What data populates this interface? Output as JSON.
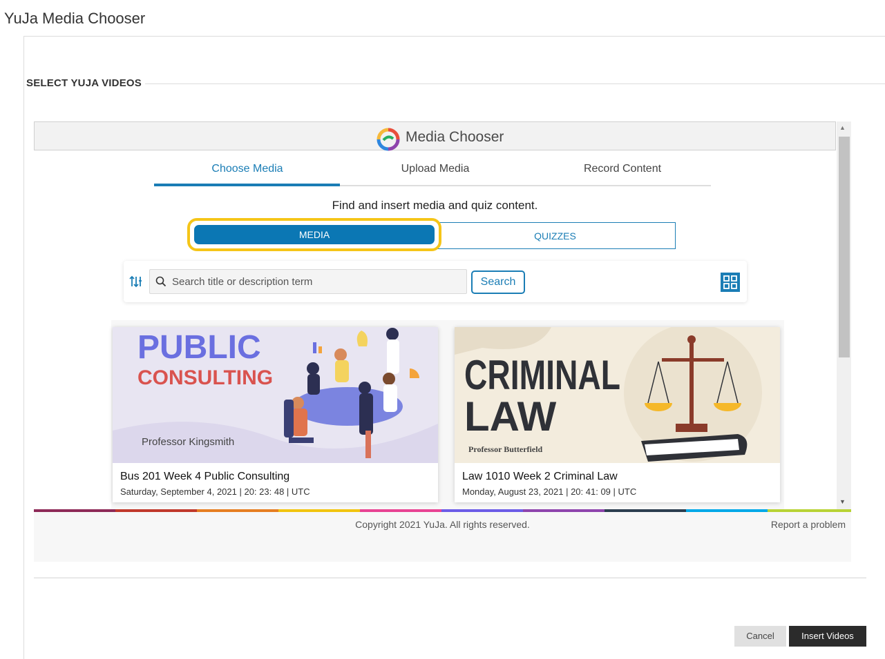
{
  "window": {
    "title": "YuJa Media Chooser"
  },
  "section": {
    "label": "SELECT YUJA VIDEOS"
  },
  "chooser": {
    "title": "Media Chooser",
    "tabs": [
      {
        "label": "Choose Media",
        "active": true
      },
      {
        "label": "Upload Media",
        "active": false
      },
      {
        "label": "Record Content",
        "active": false
      }
    ],
    "subtitle": "Find and insert media and quiz content.",
    "segments": {
      "media_label": "MEDIA",
      "quizzes_label": "QUIZZES",
      "selected": "MEDIA"
    },
    "search": {
      "placeholder": "Search title or description term",
      "value": "",
      "button_label": "Search"
    },
    "view_mode": "grid",
    "cards": [
      {
        "title": "Bus 201 Week 4 Public Consulting",
        "date": "Saturday, September 4, 2021 | 20: 23: 48 | UTC",
        "thumb_text": {
          "line1": "PUBLIC",
          "line2": "CONSULTING",
          "instructor": "Professor Kingsmith"
        }
      },
      {
        "title": "Law 1010 Week 2 Criminal Law",
        "date": "Monday, August 23, 2021 | 20: 41: 09 | UTC",
        "thumb_text": {
          "line1": "CRIMINAL",
          "line2": "LAW",
          "instructor": "Professor Butterfield"
        }
      }
    ],
    "footer": {
      "copyright": "Copyright 2021 YuJa. All rights reserved.",
      "report": "Report a problem"
    }
  },
  "actions": {
    "cancel_label": "Cancel",
    "insert_label": "Insert Videos"
  },
  "colors": {
    "accent": "#1a7db5",
    "highlight": "#f5c518",
    "segment_active": "#0b77b4",
    "primary_button": "#2b2b2b"
  },
  "icons": {
    "filter": "sort-filter-icon",
    "search": "magnifier-icon",
    "grid": "grid-view-icon",
    "logo": "yuja-logo-icon"
  }
}
